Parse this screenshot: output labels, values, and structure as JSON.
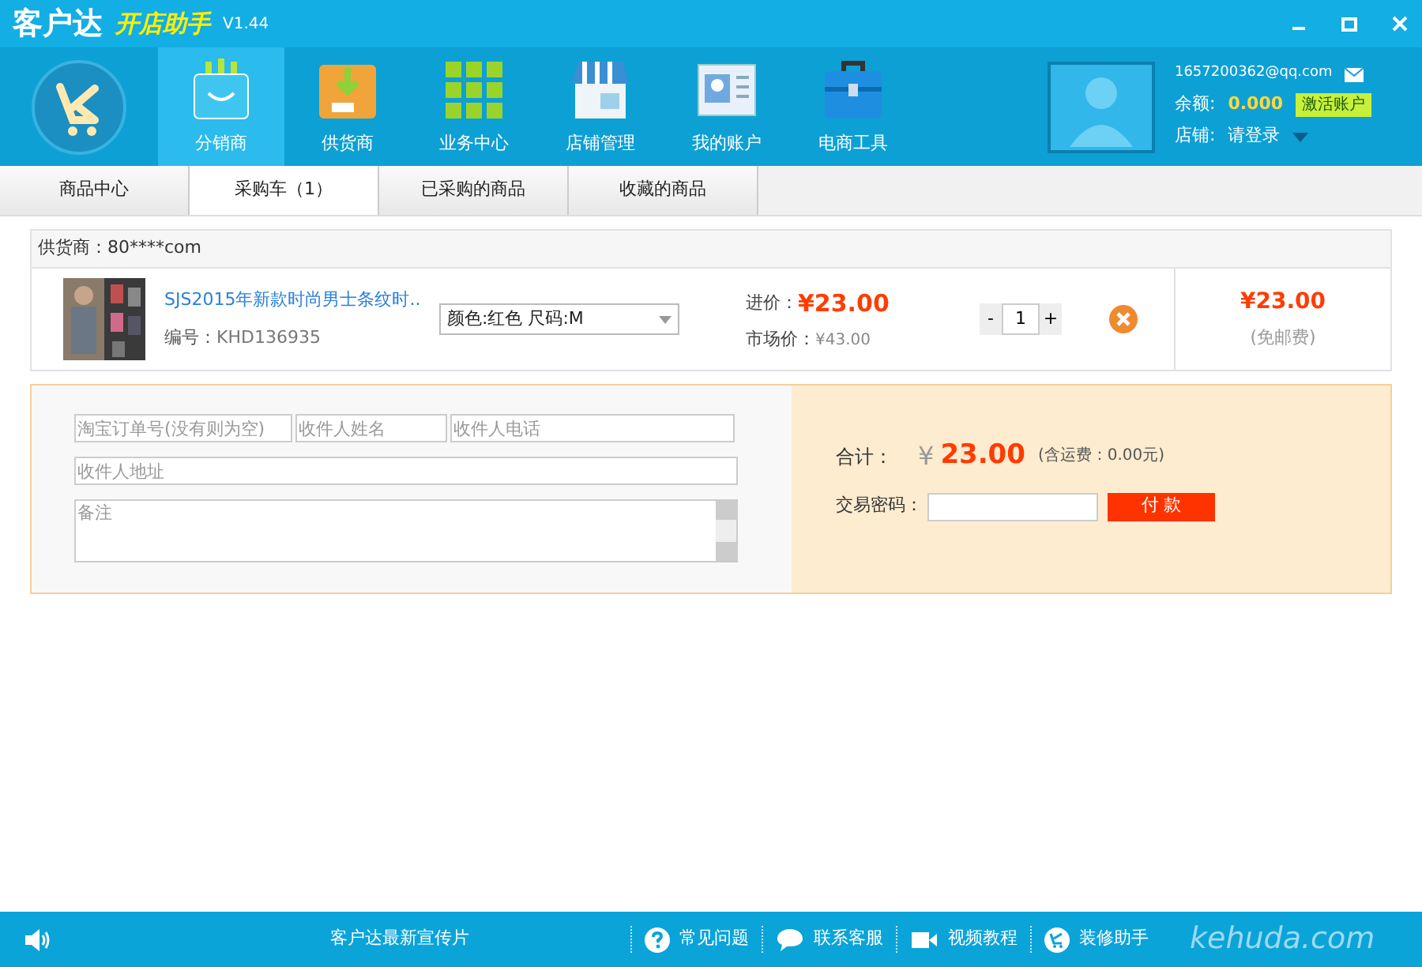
{
  "window": {
    "title": "客户达",
    "subtitle": "开店助手",
    "version": "V1.44"
  },
  "nav": [
    {
      "label": "分销商",
      "selected": true,
      "kind": "bag"
    },
    {
      "label": "供货商",
      "selected": false,
      "kind": "box"
    },
    {
      "label": "业务中心",
      "selected": false,
      "kind": "grid"
    },
    {
      "label": "店铺管理",
      "selected": false,
      "kind": "shop"
    },
    {
      "label": "我的账户",
      "selected": false,
      "kind": "card"
    },
    {
      "label": "电商工具",
      "selected": false,
      "kind": "toolbox"
    }
  ],
  "account": {
    "email": "1657200362@qq.com",
    "balance_label": "余额:",
    "balance": "0.000",
    "activate_button": "激活账户",
    "shop_label": "店铺:",
    "shop_value": "请登录"
  },
  "tabs": [
    {
      "label": "商品中心",
      "selected": false
    },
    {
      "label": "采购车（1）",
      "selected": true
    },
    {
      "label": "已采购的商品",
      "selected": false
    },
    {
      "label": "收藏的商品",
      "selected": false
    }
  ],
  "cart": {
    "supplier": "供货商：80****com",
    "item": {
      "title": "SJS2015年新款时尚男士条纹时..",
      "code_label": "编号：",
      "code": "KHD136935",
      "option": "颜色:红色 尺码:M",
      "price_label": "进价：",
      "price": "¥23.00",
      "market_label": "市场价：",
      "market_price": "¥43.00",
      "quantity": "1",
      "minus": "-",
      "plus": "+",
      "subtotal": "¥23.00",
      "shipping_note": "(免邮费)"
    }
  },
  "order": {
    "fields": [
      {
        "placeholder": "淘宝订单号(没有则为空)"
      },
      {
        "placeholder": "收件人姓名"
      },
      {
        "placeholder": "收件人电话"
      },
      {
        "placeholder": "收件人地址"
      }
    ],
    "note_placeholder": "备注",
    "total_label": "合计：",
    "currency": "¥",
    "total": "23.00",
    "shipping": "(含运费：0.00元)",
    "password_label": "交易密码：",
    "pay_button": "付 款"
  },
  "footer": {
    "promo": "客户达最新宣传片",
    "links": [
      {
        "label": "常见问题",
        "kind": "help"
      },
      {
        "label": "联系客服",
        "kind": "chat"
      },
      {
        "label": "视频教程",
        "kind": "video"
      },
      {
        "label": "装修助手",
        "kind": "cart"
      }
    ],
    "brand": "kehuda.com"
  }
}
